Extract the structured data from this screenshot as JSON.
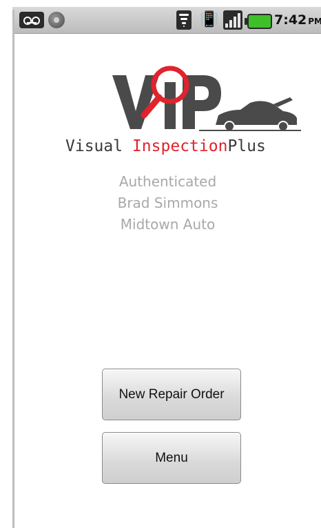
{
  "status_bar": {
    "time": "7:42",
    "ampm": "PM",
    "icons": [
      "voicemail-icon",
      "sync-icon",
      "wifi-icon",
      "vibrate-icon",
      "signal-icon",
      "battery-icon"
    ]
  },
  "logo": {
    "wordmark": "VIP",
    "name_part1": "Visual",
    "name_part2": "Inspection",
    "name_part3": "Plus",
    "accent_color": "#e0232d",
    "dark_color": "#3a3a3a"
  },
  "auth": {
    "status": "Authenticated",
    "user": "Brad Simmons",
    "dealer": "Midtown Auto"
  },
  "buttons": {
    "new_repair_order": "New Repair Order",
    "menu": "Menu"
  }
}
